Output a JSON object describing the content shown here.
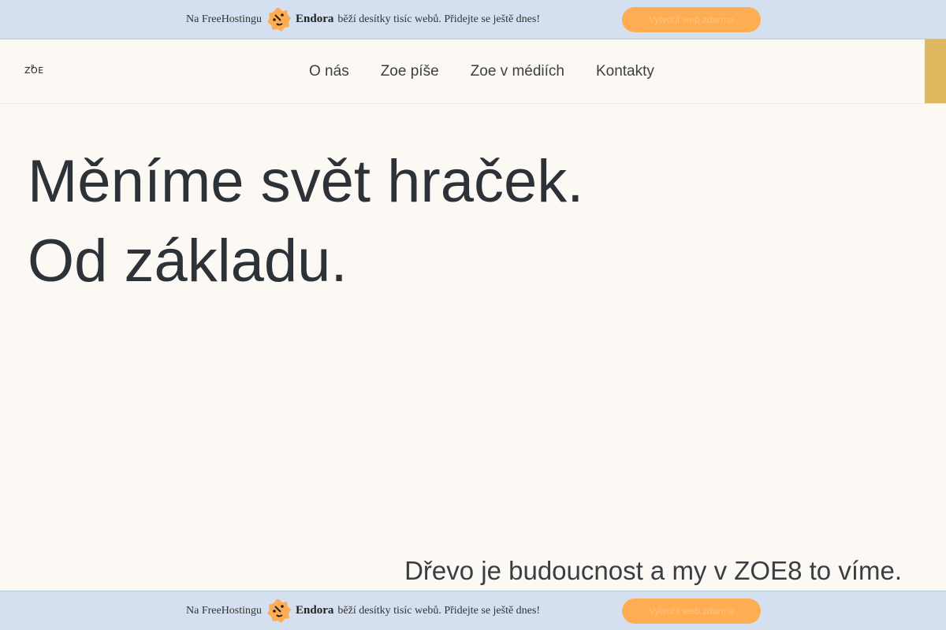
{
  "promo": {
    "lead": "Na FreeHostingu",
    "brand": "Endora",
    "message": "běží desítky tisíc webů. Přidejte se ještě dnes!",
    "cta": "Vytvořit web zdarma",
    "badge_icon": "endora-badge-icon",
    "colors": {
      "bar": "#d4e0ef",
      "cta": "#ffad52",
      "badge": "#ffad52"
    }
  },
  "header": {
    "logo_text": "ZOE",
    "logo_mark": "8",
    "nav": [
      "O nás",
      "Zoe píše",
      "Zoe v médiích",
      "Kontakty"
    ],
    "accent": "#e0b860"
  },
  "hero": {
    "line1": "Měníme svět hraček.",
    "line2": "Od základu."
  },
  "tagline": "Dřevo je budoucnost a my v ZOE8 to víme."
}
